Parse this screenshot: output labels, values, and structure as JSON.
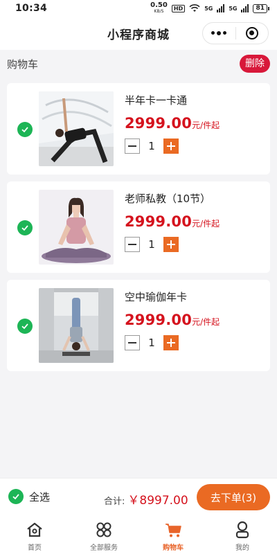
{
  "status_bar": {
    "time": "10:34",
    "net_speed": "0.50",
    "net_unit": "KB/S",
    "hd": "HD",
    "signal_1": "5G",
    "signal_2": "5G",
    "battery": "81"
  },
  "nav": {
    "title": "小程序商城",
    "more_icon": "more-dots-icon",
    "close_icon": "target-circle-icon"
  },
  "cart": {
    "title": "购物车",
    "delete_label": "删除",
    "items": [
      {
        "name": "半年卡一卡通",
        "price": "2999.00",
        "unit": "元/件起",
        "quantity": "1",
        "checked": true,
        "image": "yoga-triangle-pose"
      },
      {
        "name": "老师私教（10节）",
        "price": "2999.00",
        "unit": "元/件起",
        "quantity": "1",
        "checked": true,
        "image": "yoga-seated-pose"
      },
      {
        "name": "空中瑜伽年卡",
        "price": "2999.00",
        "unit": "元/件起",
        "quantity": "1",
        "checked": true,
        "image": "yoga-headstand-pose"
      }
    ]
  },
  "checkout": {
    "select_all_label": "全选",
    "total_label": "合计:",
    "total_amount": "￥8997.00",
    "order_button_label": "去下单(3)"
  },
  "tabs": [
    {
      "label": "首页",
      "icon": "home-icon",
      "active": false
    },
    {
      "label": "全部服务",
      "icon": "services-grid-icon",
      "active": false
    },
    {
      "label": "购物车",
      "icon": "cart-icon",
      "active": true
    },
    {
      "label": "我的",
      "icon": "profile-icon",
      "active": false
    }
  ],
  "colors": {
    "accent": "#ea6a23",
    "price": "#d5131e",
    "delete": "#d8183a",
    "check": "#1db556"
  }
}
